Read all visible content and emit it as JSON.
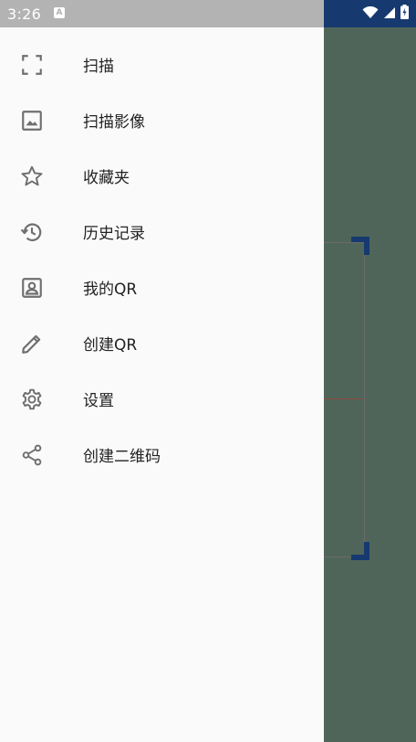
{
  "status_bar": {
    "time": "3:26",
    "notification_icon": "A",
    "icons": [
      "wifi-icon",
      "signal-icon",
      "battery-charging-icon"
    ]
  },
  "drawer": {
    "items": [
      {
        "label": "扫描",
        "icon": "scan-icon"
      },
      {
        "label": "扫描影像",
        "icon": "image-icon"
      },
      {
        "label": "收藏夹",
        "icon": "star-icon"
      },
      {
        "label": "历史记录",
        "icon": "history-icon"
      },
      {
        "label": "我的QR",
        "icon": "contact-card-icon"
      },
      {
        "label": "创建QR",
        "icon": "pencil-icon"
      },
      {
        "label": "设置",
        "icon": "gear-icon"
      },
      {
        "label": "创建二维码",
        "icon": "share-icon"
      }
    ]
  },
  "colors": {
    "drawer_bg": "#fafafa",
    "background": "#50655a",
    "accent": "#163a6f",
    "status_bar_left": "#b3b3b3",
    "icon": "#6f6f6f"
  }
}
